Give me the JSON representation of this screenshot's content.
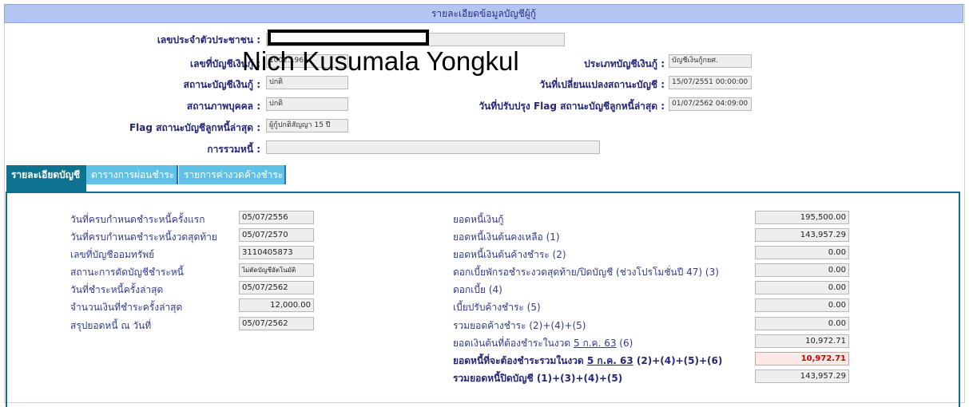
{
  "header": {
    "title": "รายละเอียดข้อมูลบัญชีผู้กู้"
  },
  "overlay_name": "Nich Kusumala Yongkul",
  "info": {
    "citizen_id": {
      "label": "เลขประจำตัวประชาชน :",
      "value": ""
    },
    "loan_account_no": {
      "label": "เลขที่บัญชีเงินกู้ :",
      "value": "1002...965"
    },
    "loan_type": {
      "label": "ประเภทบัญชีเงินกู้ :",
      "value": "บัญชีเงินกู้กยศ."
    },
    "loan_status": {
      "label": "สถานะบัญชีเงินกู้ :",
      "value": "ปกติ"
    },
    "status_change_date": {
      "label": "วันที่เปลี่ยนแปลงสถานะบัญชี :",
      "value": "15/07/2551 00:00:00"
    },
    "person_status": {
      "label": "สถานภาพบุคคล :",
      "value": "ปกติ"
    },
    "flag_update_date": {
      "label": "วันที่ปรับปรุง Flag สถานะบัญชีลูกหนี้ล่าสุด :",
      "value": "01/07/2562 04:09:00"
    },
    "flag_status": {
      "label": "Flag สถานะบัญชีลูกหนี้ล่าสุด :",
      "value": "ผู้กู้ปกติสัญญา 15 ปี"
    },
    "debt_merge": {
      "label": "การรวมหนี้ :",
      "value": ""
    }
  },
  "tabs": [
    {
      "label": "รายละเอียดบัญชี",
      "active": true
    },
    {
      "label": "ตารางการผ่อนชำระ",
      "active": false
    },
    {
      "label": "รายการค่างวดค้างชำระ",
      "active": false
    }
  ],
  "details_left": [
    {
      "label": "วันที่ครบกำหนดชำระหนี้ครั้งแรก",
      "value": "05/07/2556"
    },
    {
      "label": "วันที่ครบกำหนดชำระหนี้งวดสุดท้าย",
      "value": "05/07/2570"
    },
    {
      "label": "เลขที่บัญชีออมทรัพย์",
      "value": "3110405873"
    },
    {
      "label": "สถานะการตัดบัญชีชำระหนี้",
      "value": "ไม่ตัดบัญชีอัตโนมัติ"
    },
    {
      "label": "วันที่ชำระหนี้ครั้งล่าสุด",
      "value": "05/07/2562"
    },
    {
      "label": "จำนวนเงินที่ชำระครั้งล่าสุด",
      "value": "12,000.00"
    },
    {
      "label": "สรุปยอดหนี้ ณ วันที่",
      "value": "05/07/2562"
    }
  ],
  "details_right": [
    {
      "label": "ยอดหนี้เงินกู้",
      "value": "195,500.00"
    },
    {
      "label": "ยอดหนี้เงินต้นคงเหลือ (1)",
      "value": "143,957.29"
    },
    {
      "label": "ยอดหนี้เงินต้นค้างชำระ (2)",
      "value": "0.00"
    },
    {
      "label": "ดอกเบี้ยพักรอชำระงวดสุดท้าย/ปิดบัญชี (ช่วงโปรโมชั่นปี 47) (3)",
      "value": "0.00"
    },
    {
      "label": "ดอกเบี้ย (4)",
      "value": "0.00"
    },
    {
      "label": "เบี้ยปรับค้างชำระ (5)",
      "value": "0.00"
    },
    {
      "label": "รวมยอดค้างชำระ (2)+(4)+(5)",
      "value": "0.00"
    },
    {
      "label": "ยอดเงินต้นที่ต้องชำระในงวด ",
      "label_date": "5 ก.ค. 63",
      "label_suffix": " (6)",
      "value": "10,972.71"
    },
    {
      "label": "ยอดหนี้ที่จะต้องชำระรวมในงวด ",
      "label_date": "5 ก.ค. 63",
      "label_suffix": " (2)+(4)+(5)+(6)",
      "value": "10,972.71"
    },
    {
      "label": "รวมยอดหนี้ปิดบัญชี (1)+(3)+(4)+(5)",
      "value": "143,957.29"
    }
  ]
}
